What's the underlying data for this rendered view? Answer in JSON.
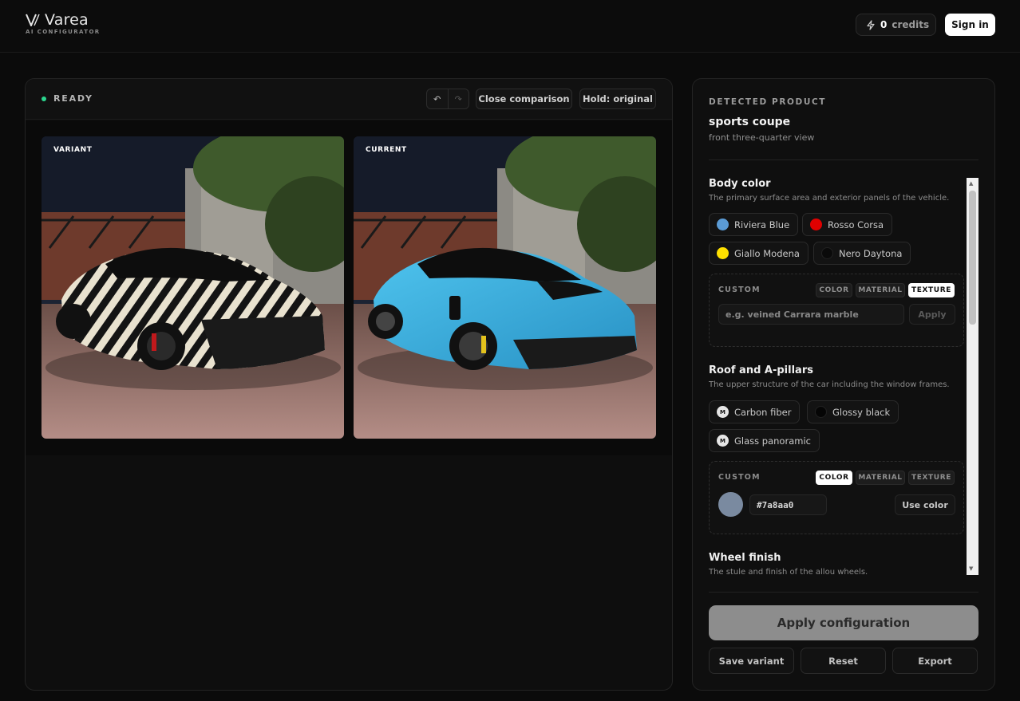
{
  "header": {
    "brand": "Varea",
    "brand_sub": "AI CONFIGURATOR",
    "credits_value": "0",
    "credits_label": "credits",
    "sign_in": "Sign in"
  },
  "viewer": {
    "status": "READY",
    "undo_icon": "undo-icon",
    "redo_icon": "redo-icon",
    "close_comparison": "Close comparison",
    "hold_original": "Hold: original",
    "variant_label": "VARIANT",
    "current_label": "CURRENT"
  },
  "product": {
    "section_label": "DETECTED PRODUCT",
    "name": "sports coupe",
    "view": "front three-quarter view"
  },
  "sections": {
    "body": {
      "title": "Body color",
      "desc": "The primary surface area and exterior panels of the vehicle.",
      "options": [
        {
          "label": "Riviera Blue",
          "color": "#5b9bd5"
        },
        {
          "label": "Rosso Corsa",
          "color": "#e00000"
        },
        {
          "label": "Giallo Modena",
          "color": "#ffe100"
        },
        {
          "label": "Nero Daytona",
          "color": "#0a0a0a"
        }
      ],
      "custom_label": "CUSTOM",
      "modes": [
        "COLOR",
        "MATERIAL",
        "TEXTURE"
      ],
      "active_mode": "TEXTURE",
      "input_placeholder": "e.g. veined Carrara marble",
      "apply": "Apply"
    },
    "roof": {
      "title": "Roof and A-pillars",
      "desc": "The upper structure of the car including the window frames.",
      "options": [
        {
          "label": "Carbon fiber",
          "badge": "M"
        },
        {
          "label": "Glossy black",
          "color": "#050505"
        },
        {
          "label": "Glass panoramic",
          "badge": "M"
        }
      ],
      "custom_label": "CUSTOM",
      "modes": [
        "COLOR",
        "MATERIAL",
        "TEXTURE"
      ],
      "active_mode": "COLOR",
      "color_value": "#7a8aa0",
      "use_color": "Use color"
    },
    "wheel": {
      "title": "Wheel finish",
      "desc": "The stule and finish of the allou wheels."
    }
  },
  "actions": {
    "apply_configuration": "Apply configuration",
    "save_variant": "Save variant",
    "reset": "Reset",
    "export": "Export"
  }
}
